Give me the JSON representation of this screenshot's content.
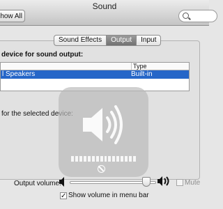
{
  "window": {
    "title": "Sound"
  },
  "toolbar": {
    "show_all_label": "how All"
  },
  "tabs": [
    {
      "label": "Sound Effects",
      "active": false
    },
    {
      "label": "Output",
      "active": true
    },
    {
      "label": "Input",
      "active": false
    }
  ],
  "output": {
    "heading": " device for sound output:",
    "columns": [
      "",
      "Type"
    ],
    "rows": [
      {
        "name": "l Speakers",
        "type": "Built-in",
        "selected": true
      }
    ],
    "settings_heading": " for the selected device:"
  },
  "volume": {
    "label": "Output volume:",
    "level": 0.93,
    "mute_label": "Mute",
    "mute_checked": false,
    "show_in_menu_bar_label": "Show volume in menu bar",
    "show_in_menu_bar_checked": true,
    "checkmark": "✓"
  },
  "hud": {
    "segments": 16,
    "filled": 16
  },
  "colors": {
    "selection": "#2566c8",
    "hud": "#b9b9b9"
  }
}
